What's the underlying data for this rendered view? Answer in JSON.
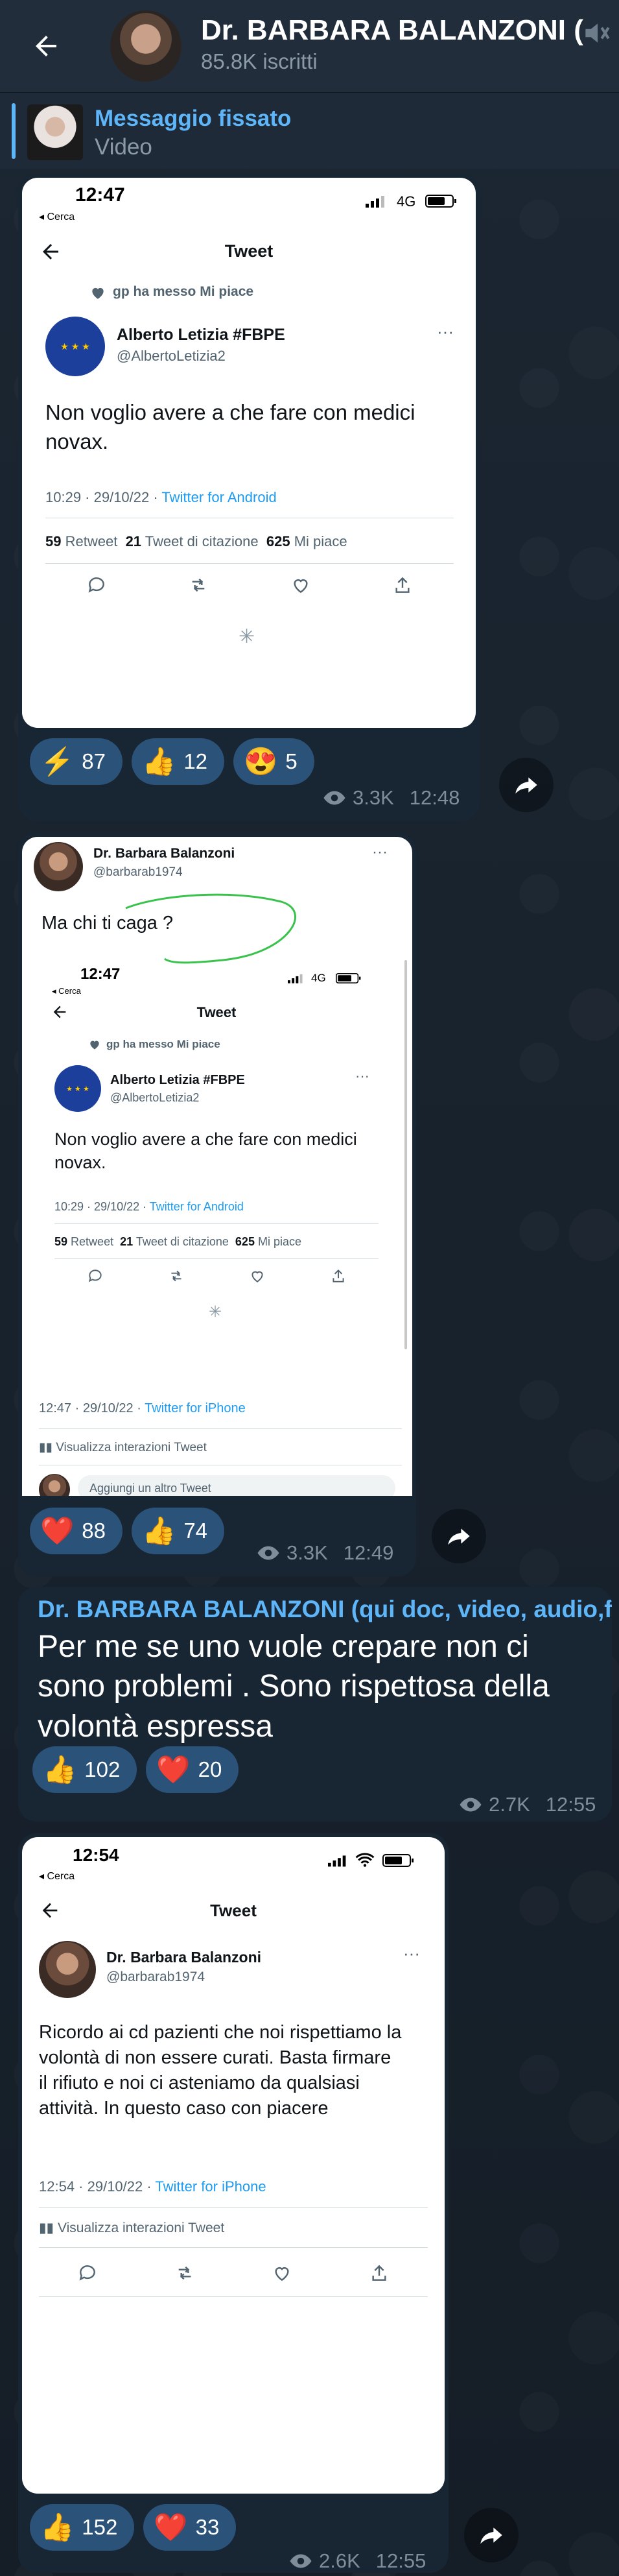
{
  "header": {
    "title": "Dr. BARBARA BALANZONI (",
    "subscribers": "85.8K iscritti"
  },
  "pinned": {
    "title": "Messaggio fissato",
    "subtitle": "Video"
  },
  "posts": [
    {
      "shot": {
        "time": "12:47",
        "back_label": "◂ Cerca",
        "network": "4G",
        "header": "Tweet",
        "liked_by": "gp ha messo Mi piace",
        "name": "Alberto Letizia #FBPE",
        "handle": "@AlbertoLetizia2",
        "body": "Non voglio avere a che fare con medici novax.",
        "timestamp": "10:29 · 29/10/22 ·",
        "source": "Twitter for Android",
        "retweets": "59",
        "retweets_label": "Retweet",
        "quotes": "21",
        "quotes_label": "Tweet di citazione",
        "likes": "625",
        "likes_label": "Mi piace"
      },
      "reactions": [
        {
          "emoji": "⚡",
          "count": "87"
        },
        {
          "emoji": "👍",
          "count": "12"
        },
        {
          "emoji": "😍",
          "count": "5"
        }
      ],
      "views": "3.3K",
      "time": "12:48"
    },
    {
      "shot": {
        "name": "Dr. Barbara Balanzoni",
        "handle": "@barbarab1974",
        "body": "Ma chi ti caga ?",
        "inner_time": "12:47",
        "inner_back": "◂ Cerca",
        "inner_network": "4G",
        "inner_header": "Tweet",
        "inner_liked_by": "gp ha messo Mi piace",
        "inner_name": "Alberto Letizia #FBPE",
        "inner_handle": "@AlbertoLetizia2",
        "inner_body": "Non voglio avere a che fare con medici novax.",
        "inner_timestamp": "10:29 · 29/10/22 ·",
        "inner_source": "Twitter for Android",
        "inner_retweets": "59",
        "inner_retweets_label": "Retweet",
        "inner_quotes": "21",
        "inner_quotes_label": "Tweet di citazione",
        "inner_likes": "625",
        "inner_likes_label": "Mi piace",
        "timestamp": "12:47 · 29/10/22 ·",
        "source": "Twitter for iPhone",
        "interactions": "Visualizza interazioni Tweet",
        "reply_placeholder": "Aggiungi un altro Tweet"
      },
      "reactions": [
        {
          "emoji": "❤️",
          "count": "88"
        },
        {
          "emoji": "👍",
          "count": "74"
        }
      ],
      "views": "3.3K",
      "time": "12:49"
    },
    {
      "sender": "Dr. BARBARA BALANZONI (qui doc, video, audio,fot...",
      "text": "Per me se uno vuole crepare  non ci sono problemi . Sono rispettosa della volontà espressa",
      "reactions": [
        {
          "emoji": "👍",
          "count": "102"
        },
        {
          "emoji": "❤️",
          "count": "20"
        }
      ],
      "views": "2.7K",
      "time": "12:55"
    },
    {
      "shot": {
        "time": "12:54",
        "back_label": "◂ Cerca",
        "header": "Tweet",
        "name": "Dr. Barbara Balanzoni",
        "handle": "@barbarab1974",
        "body": "Ricordo ai cd pazienti che noi rispettiamo la volontà di non essere curati. Basta firmare  il rifiuto e noi ci asteniamo da qualsiasi attività. In questo caso con piacere",
        "timestamp": "12:54 · 29/10/22 ·",
        "source": "Twitter for iPhone",
        "interactions": "Visualizza interazioni Tweet"
      },
      "reactions": [
        {
          "emoji": "👍",
          "count": "152"
        },
        {
          "emoji": "❤️",
          "count": "33"
        }
      ],
      "views": "2.6K",
      "time": "12:55"
    }
  ],
  "colors": {
    "header_bg": "#212d3b",
    "bubble_bg": "#182533",
    "accent": "#5eb5f7",
    "reaction_bg": "#2b5278",
    "meta": "#7f8d9b"
  }
}
